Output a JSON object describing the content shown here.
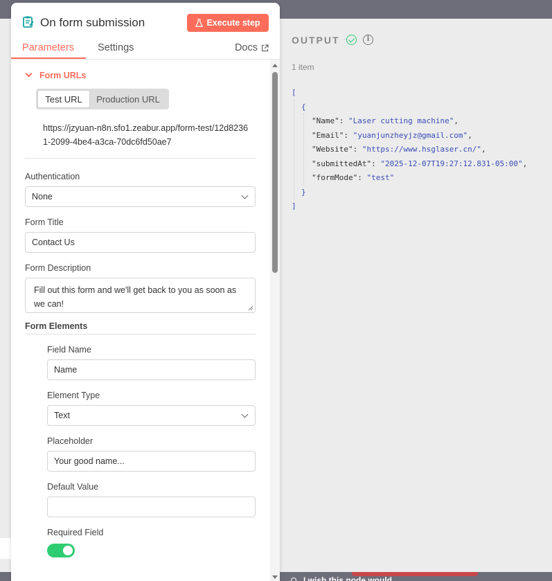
{
  "node": {
    "title": "On form submission",
    "execute_label": "Execute step"
  },
  "tabs": {
    "parameters": "Parameters",
    "settings": "Settings",
    "docs": "Docs"
  },
  "form_urls": {
    "section_label": "Form URLs",
    "test_tab": "Test URL",
    "production_tab": "Production URL",
    "url": "https://jzyuan-n8n.sfo1.zeabur.app/form-test/12d82361-2099-4be4-a3ca-70dc6fd50ae7"
  },
  "authentication": {
    "label": "Authentication",
    "value": "None"
  },
  "form_title": {
    "label": "Form Title",
    "value": "Contact Us"
  },
  "form_description": {
    "label": "Form Description",
    "value": "Fill out this form and we'll get back to you as soon as we can!"
  },
  "form_elements": {
    "label": "Form Elements",
    "field_name_label": "Field Name",
    "field_name_value": "Name",
    "element_type_label": "Element Type",
    "element_type_value": "Text",
    "placeholder_label": "Placeholder",
    "placeholder_value": "Your good name...",
    "default_value_label": "Default Value",
    "default_value_value": "",
    "required_label": "Required Field",
    "required": true
  },
  "output": {
    "title": "OUTPUT",
    "count": "1 item",
    "json": {
      "open_bracket": "[",
      "open_brace": "{",
      "close_brace": "}",
      "close_bracket": "]",
      "fields": [
        {
          "key": "\"Name\"",
          "value": "\"Laser cutting machine\""
        },
        {
          "key": "\"Email\"",
          "value": "\"yuanjunzheyjz@gmail.com\""
        },
        {
          "key": "\"Website\"",
          "value": "\"https://www.hsglaser.cn/\""
        },
        {
          "key": "\"submittedAt\"",
          "value": "\"2025-12-07T19:27:12.831-05:00\""
        },
        {
          "key": "\"formMode\"",
          "value": "\"test\""
        }
      ]
    }
  },
  "bottom_hint": "I wish this node would...",
  "colors": {
    "accent": "#ff6d5a",
    "success": "#2ecc71",
    "json_string": "#3a4cb8"
  }
}
